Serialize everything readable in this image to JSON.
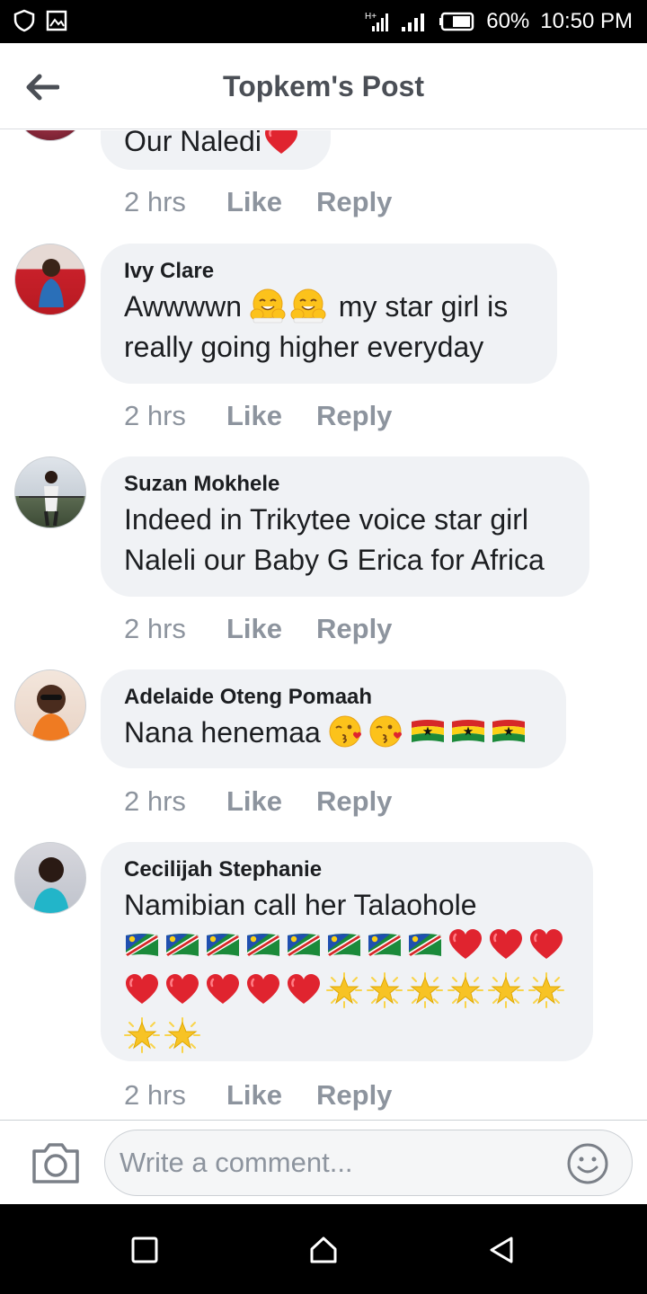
{
  "status_bar": {
    "battery_percent": "60%",
    "time": "10:50 PM",
    "icons": [
      "shield-icon",
      "image-icon",
      "sim-icon",
      "signal-icon",
      "battery-icon"
    ]
  },
  "header": {
    "title": "Topkem's Post",
    "back_icon": "arrow-left-icon"
  },
  "comments": [
    {
      "author": "",
      "text": "Our Naledi",
      "trailing_emojis": [
        "red-heart"
      ],
      "time": "2 hrs",
      "like": "Like",
      "reply": "Reply"
    },
    {
      "author": "Ivy Clare",
      "text_before": "Awwwwn",
      "mid_emojis": [
        "hugging-face",
        "hugging-face"
      ],
      "text_after": "my star girl is really going higher everyday",
      "time": "2 hrs",
      "like": "Like",
      "reply": "Reply"
    },
    {
      "author": "Suzan Mokhele",
      "text": "Indeed in Trikytee voice star girl Naleli our Baby G Erica for Africa",
      "time": "2 hrs",
      "like": "Like",
      "reply": "Reply"
    },
    {
      "author": "Adelaide Oteng Pomaah",
      "text": "Nana henemaa",
      "trailing_emojis": [
        "face-blowing-kiss",
        "face-blowing-kiss",
        "flag-ghana",
        "flag-ghana",
        "flag-ghana"
      ],
      "time": "2 hrs",
      "like": "Like",
      "reply": "Reply"
    },
    {
      "author": "Cecilijah Stephanie",
      "text": "Namibian call her Talaohole",
      "trailing_emojis": [
        "flag-namibia",
        "flag-namibia",
        "flag-namibia",
        "flag-namibia",
        "flag-namibia",
        "flag-namibia",
        "flag-namibia",
        "flag-namibia",
        "red-heart",
        "red-heart",
        "red-heart",
        "red-heart",
        "red-heart",
        "red-heart",
        "red-heart",
        "red-heart",
        "glowing-star",
        "glowing-star",
        "glowing-star",
        "glowing-star",
        "glowing-star",
        "glowing-star",
        "glowing-star",
        "glowing-star"
      ],
      "time": "2 hrs",
      "like": "Like",
      "reply": "Reply"
    }
  ],
  "composer": {
    "placeholder": "Write a comment...",
    "camera_icon": "camera-icon",
    "emoji_icon": "smiley-icon"
  },
  "nav_bar": {
    "icons": [
      "square-icon",
      "home-icon",
      "back-triangle-icon"
    ]
  },
  "colors": {
    "bubble": "#f0f2f5",
    "meta_text": "#8d949e",
    "title_text": "#4b4f56",
    "heart": "#e0242f",
    "star": "#f7c325"
  }
}
